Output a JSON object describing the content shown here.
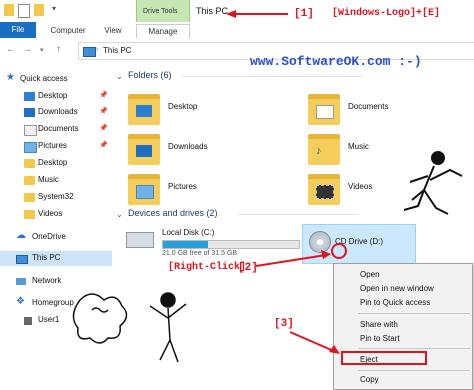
{
  "titlebar": {
    "context_tab": "Drive Tools",
    "title": "This PC"
  },
  "ribbon": {
    "tabs": [
      "File",
      "Computer",
      "View",
      "Manage"
    ]
  },
  "address": {
    "path": "This PC"
  },
  "sidebar": {
    "items": [
      {
        "label": "Quick access",
        "icon": "star-icon",
        "pinned": false
      },
      {
        "label": "Desktop",
        "icon": "desktop-icon",
        "pinned": true
      },
      {
        "label": "Downloads",
        "icon": "download-icon",
        "pinned": true
      },
      {
        "label": "Documents",
        "icon": "document-icon",
        "pinned": true
      },
      {
        "label": "Pictures",
        "icon": "picture-icon",
        "pinned": true
      },
      {
        "label": "Desktop",
        "icon": "folder-icon",
        "pinned": false
      },
      {
        "label": "Music",
        "icon": "folder-icon",
        "pinned": false
      },
      {
        "label": "System32",
        "icon": "folder-icon",
        "pinned": false
      },
      {
        "label": "Videos",
        "icon": "folder-icon",
        "pinned": false
      },
      {
        "label": "OneDrive",
        "icon": "cloud-icon",
        "pinned": false
      },
      {
        "label": "This PC",
        "icon": "computer-icon",
        "pinned": false
      },
      {
        "label": "Network",
        "icon": "network-icon",
        "pinned": false
      },
      {
        "label": "Homegroup",
        "icon": "homegroup-icon",
        "pinned": false
      },
      {
        "label": "User1",
        "icon": "user-icon",
        "pinned": false
      }
    ],
    "pin_glyph": "📌"
  },
  "folders": {
    "heading": "Folders (6)",
    "items": [
      "Desktop",
      "Documents",
      "Downloads",
      "Music",
      "Pictures",
      "Videos"
    ]
  },
  "drives": {
    "heading": "Devices and drives (2)",
    "local": {
      "name": "Local Disk (C:)",
      "free_text": "21.0 GB free of 31.5 GB",
      "used_fraction": 0.33
    },
    "cd": {
      "name": "CD Drive (D:)"
    }
  },
  "context_menu": {
    "items": [
      "Open",
      "Open in new window",
      "Pin to Quick access",
      "Share with",
      "Pin to Start",
      "Eject",
      "Copy"
    ]
  },
  "annotations": {
    "label_1": "[1]",
    "shortcut": "[Windows-Logo]+[E]",
    "brand": "www.SoftwareOK.com :-)",
    "right_click": "[Right-Click]",
    "label_2": "[2]",
    "label_3": "[3]",
    "accent_red": "#e0141e",
    "accent_blue": "#2a4fd1"
  }
}
